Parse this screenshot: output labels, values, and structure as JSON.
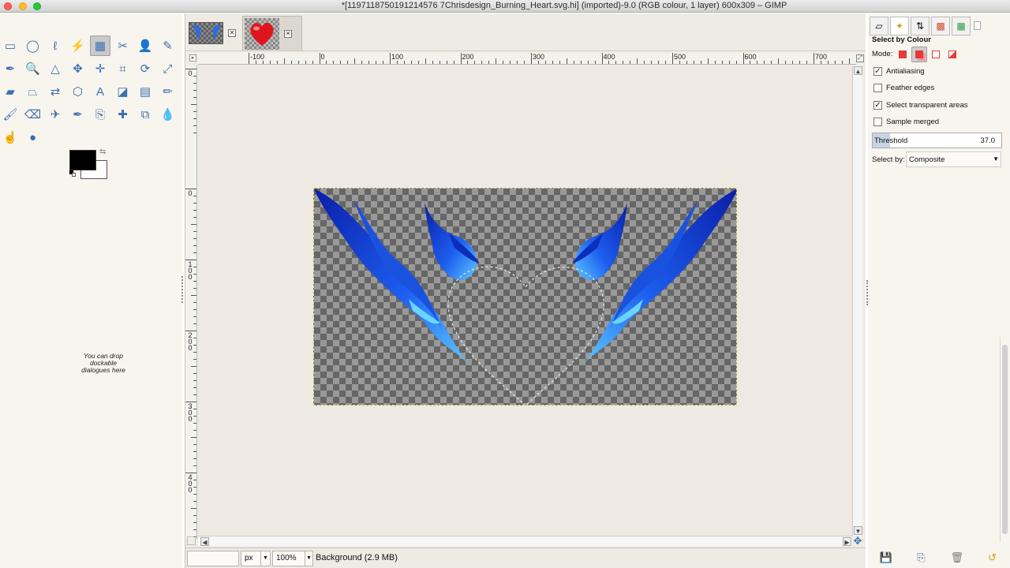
{
  "window": {
    "title": "*[1197118750191214576 7Chrisdesign_Burning_Heart.svg.hi] (imported)-9.0 (RGB colour, 1 layer) 600x309 – GIMP"
  },
  "toolbox": {
    "tools": [
      {
        "name": "rect-select-tool",
        "glyph": "▭"
      },
      {
        "name": "ellipse-select-tool",
        "glyph": "◯"
      },
      {
        "name": "free-select-tool",
        "glyph": "ℓ"
      },
      {
        "name": "fuzzy-select-tool",
        "glyph": "⚡"
      },
      {
        "name": "select-by-colour-tool",
        "glyph": "▦",
        "active": true
      },
      {
        "name": "scissors-select-tool",
        "glyph": "✂"
      },
      {
        "name": "foreground-select-tool",
        "glyph": "👤"
      },
      {
        "name": "paths-tool",
        "glyph": "✎"
      },
      {
        "name": "colour-picker-tool",
        "glyph": "✒"
      },
      {
        "name": "zoom-tool",
        "glyph": "🔍"
      },
      {
        "name": "measure-tool",
        "glyph": "△"
      },
      {
        "name": "move-tool",
        "glyph": "✥"
      },
      {
        "name": "align-tool",
        "glyph": "✛"
      },
      {
        "name": "crop-tool",
        "glyph": "⌗"
      },
      {
        "name": "rotate-tool",
        "glyph": "⟳"
      },
      {
        "name": "scale-tool",
        "glyph": "⤢"
      },
      {
        "name": "shear-tool",
        "glyph": "▰"
      },
      {
        "name": "perspective-tool",
        "glyph": "⏢"
      },
      {
        "name": "flip-tool",
        "glyph": "⇄"
      },
      {
        "name": "cage-tool",
        "glyph": "⬡"
      },
      {
        "name": "text-tool",
        "glyph": "A"
      },
      {
        "name": "bucket-fill-tool",
        "glyph": "◪"
      },
      {
        "name": "blend-tool",
        "glyph": "▤"
      },
      {
        "name": "pencil-tool",
        "glyph": "✏"
      },
      {
        "name": "paintbrush-tool",
        "glyph": "🖌"
      },
      {
        "name": "eraser-tool",
        "glyph": "⌫"
      },
      {
        "name": "airbrush-tool",
        "glyph": "✈"
      },
      {
        "name": "ink-tool",
        "glyph": "✒"
      },
      {
        "name": "clone-tool",
        "glyph": "⎘"
      },
      {
        "name": "heal-tool",
        "glyph": "✚"
      },
      {
        "name": "perspective-clone-tool",
        "glyph": "⧉"
      },
      {
        "name": "blur-tool",
        "glyph": "💧"
      },
      {
        "name": "smudge-tool",
        "glyph": "☝"
      },
      {
        "name": "dodge-burn-tool",
        "glyph": "●"
      }
    ],
    "drop_hint": "You can drop dockable dialogues here"
  },
  "image_window": {
    "tabs": [
      {
        "name": "image-tab-1"
      },
      {
        "name": "image-tab-2"
      }
    ],
    "ruler_h": [
      "-100",
      "0",
      "100",
      "200",
      "300",
      "400",
      "500",
      "600",
      "700"
    ],
    "ruler_v": [
      "0",
      "0",
      "100",
      "200",
      "300",
      "400"
    ],
    "status": {
      "unit": "px",
      "zoom": "100%",
      "message": "Background (2.9 MB)"
    }
  },
  "dock": {
    "title": "Select by Colour",
    "mode_label": "Mode:",
    "options": [
      {
        "label": "Antialiasing",
        "checked": true
      },
      {
        "label": "Feather edges",
        "checked": false
      },
      {
        "label": "Select transparent areas",
        "checked": true
      },
      {
        "label": "Sample merged",
        "checked": false
      }
    ],
    "threshold_label": "Threshold",
    "threshold_value": "37.0",
    "select_by_label": "Select by:",
    "select_by_value": "Composite"
  },
  "colors": {
    "accent": "#3b6fb0",
    "flame_dark": "#0b2ec0",
    "flame_light": "#3fa8ff",
    "selection_marquee": "#e4e27a"
  }
}
